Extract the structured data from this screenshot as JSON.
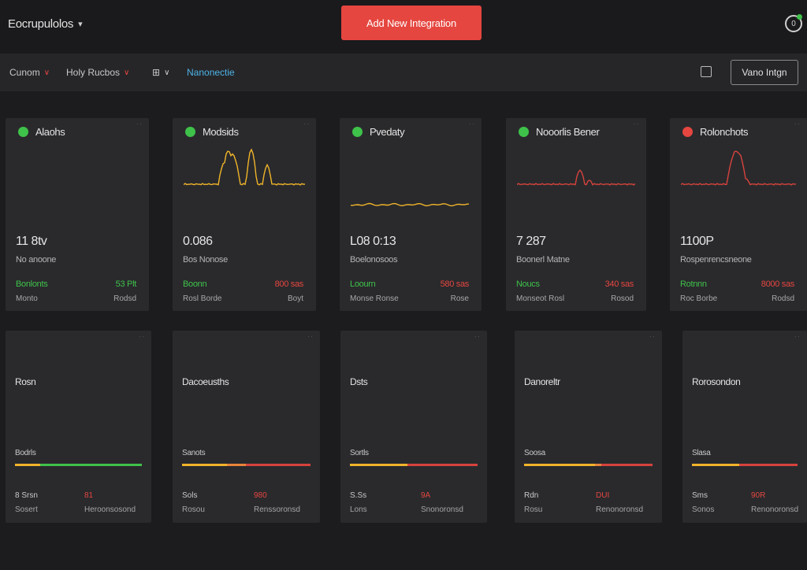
{
  "header": {
    "workspace_label": "Eocrupulolos",
    "add_button_label": "Add New Integration",
    "timer_icon_glyph": "0"
  },
  "filters": {
    "items": [
      {
        "label": "Cunom"
      },
      {
        "label": "Holy Rucbos"
      },
      {
        "label": "⊞"
      }
    ],
    "link_label": "Nanonectie",
    "manage_button_label": "Vano Intgn"
  },
  "colors": {
    "accent": "#e5463f",
    "ok": "#3fc24a",
    "link": "#4db3e6",
    "warn": "#f0b429"
  },
  "cards_top": [
    {
      "name": "Alaohs",
      "status": "ok",
      "value": "11 8tv",
      "sub": "No anoone",
      "stat_left": "Bonlonts",
      "stat_right": "53 Plt",
      "stat_right_color": "ok",
      "meta_left": "Monto",
      "meta_right": "Rodsd",
      "spark": "none"
    },
    {
      "name": "Modsids",
      "status": "ok",
      "value": "0.086",
      "sub": "Bos Nonose",
      "stat_left": "Boonn",
      "stat_right": "800 sas",
      "stat_right_color": "alert",
      "meta_left": "Rosl Borde",
      "meta_right": "Boyt",
      "spark": "peaks-yellow"
    },
    {
      "name": "Pvedaty",
      "status": "ok",
      "value": "L08 0:13",
      "sub": "Boelonosoos",
      "stat_left": "Loourn",
      "stat_right": "580 sas",
      "stat_right_color": "alert",
      "meta_left": "Monse Ronse",
      "meta_right": "Rose",
      "spark": "flat-yellow"
    },
    {
      "name": "Nooorlis Bener",
      "status": "ok",
      "value": "7 287",
      "sub": "Boonerl Matne",
      "stat_left": "Noucs",
      "stat_right": "340 sas",
      "stat_right_color": "alert",
      "meta_left": "Monseot Rosl",
      "meta_right": "Rosod",
      "spark": "spike-red-small"
    },
    {
      "name": "Rolonchots",
      "status": "alert",
      "value": "1100P",
      "sub": "Rospenrencsneone",
      "stat_left": "Rotnnn",
      "stat_right": "8000 sas",
      "stat_right_color": "alert",
      "meta_left": "Roc Borbe",
      "meta_right": "Rodsd",
      "spark": "spike-red-big"
    }
  ],
  "cards_bottom": [
    {
      "title": "Rosn",
      "section": "Bodrls",
      "row1_left": "8 Srsn",
      "row1_right": "81",
      "row2_left": "Sosert",
      "row2_right": "Heroonsosond",
      "bar": [
        0.2,
        0.8,
        0
      ]
    },
    {
      "title": "Dacoeusths",
      "section": "Sanots",
      "row1_left": "Sols",
      "row1_right": "980",
      "row2_left": "Rosou",
      "row2_right": "Renssoronsd",
      "bar": [
        0.35,
        0.15,
        0.5
      ]
    },
    {
      "title": "Dsts",
      "section": "Sortls",
      "row1_left": "S.Ss",
      "row1_right": "9A",
      "row2_left": "Lons",
      "row2_right": "Snonoronsd",
      "bar": [
        0.45,
        0,
        0.55
      ]
    },
    {
      "title": "Danoreltr",
      "section": "Soosa",
      "row1_left": "Rdn",
      "row1_right": "DUI",
      "row2_left": "Rosu",
      "row2_right": "Renonoronsd",
      "bar": [
        0.55,
        0.05,
        0.4
      ]
    },
    {
      "title": "Rorosondon",
      "section": "Slasa",
      "row1_left": "Sms",
      "row1_right": "90R",
      "row2_left": "Sonos",
      "row2_right": "Renonoronsd",
      "bar": [
        0.45,
        0,
        0.55
      ]
    }
  ]
}
